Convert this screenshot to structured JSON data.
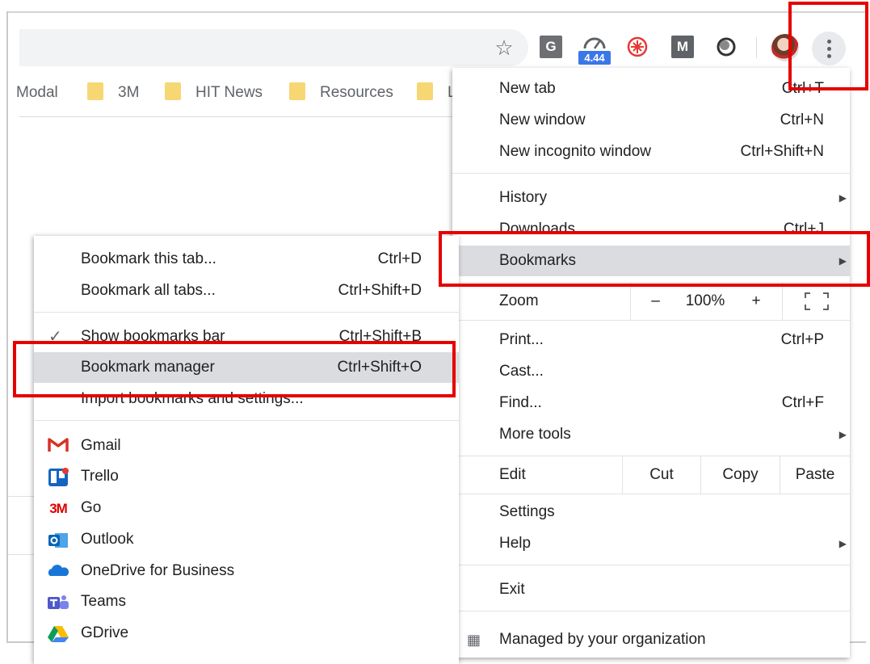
{
  "toolbar": {
    "ext_g_label": "G",
    "ext_speed_badge": "4.44",
    "ext_m_label": "M"
  },
  "bookmarks_bar": {
    "items": [
      {
        "label": "Modal"
      },
      {
        "label": "3M"
      },
      {
        "label": "HIT News"
      },
      {
        "label": "Resources"
      },
      {
        "label": "L"
      }
    ]
  },
  "main_menu": {
    "new_tab": {
      "label": "New tab",
      "shortcut": "Ctrl+T"
    },
    "new_window": {
      "label": "New window",
      "shortcut": "Ctrl+N"
    },
    "new_incognito": {
      "label": "New incognito window",
      "shortcut": "Ctrl+Shift+N"
    },
    "history": {
      "label": "History"
    },
    "downloads": {
      "label": "Downloads",
      "shortcut": "Ctrl+J"
    },
    "bookmarks": {
      "label": "Bookmarks"
    },
    "zoom": {
      "label": "Zoom",
      "minus": "–",
      "value": "100%",
      "plus": "+"
    },
    "print": {
      "label": "Print...",
      "shortcut": "Ctrl+P"
    },
    "cast": {
      "label": "Cast..."
    },
    "find": {
      "label": "Find...",
      "shortcut": "Ctrl+F"
    },
    "more_tools": {
      "label": "More tools"
    },
    "edit": {
      "label": "Edit",
      "cut": "Cut",
      "copy": "Copy",
      "paste": "Paste"
    },
    "settings": {
      "label": "Settings"
    },
    "help": {
      "label": "Help"
    },
    "exit": {
      "label": "Exit"
    },
    "managed": {
      "label": "Managed by your organization"
    }
  },
  "bookmarks_submenu": {
    "bookmark_tab": {
      "label": "Bookmark this tab...",
      "shortcut": "Ctrl+D"
    },
    "bookmark_all": {
      "label": "Bookmark all tabs...",
      "shortcut": "Ctrl+Shift+D"
    },
    "show_bar": {
      "label": "Show bookmarks bar",
      "shortcut": "Ctrl+Shift+B"
    },
    "manager": {
      "label": "Bookmark manager",
      "shortcut": "Ctrl+Shift+O"
    },
    "import": {
      "label": "Import bookmarks and settings..."
    },
    "bookmarks": [
      {
        "label": "Gmail",
        "icon": "gmail-icon"
      },
      {
        "label": "Trello",
        "icon": "trello-icon"
      },
      {
        "label": "Go",
        "icon": "3m-icon",
        "icon_text": "3M"
      },
      {
        "label": "Outlook",
        "icon": "outlook-icon"
      },
      {
        "label": "OneDrive for Business",
        "icon": "onedrive-icon"
      },
      {
        "label": "Teams",
        "icon": "teams-icon"
      },
      {
        "label": "GDrive",
        "icon": "gdrive-icon"
      }
    ]
  },
  "colors": {
    "highlight_box": "#e60000",
    "menu_highlight": "#dadce0",
    "folder": "#f7d774"
  }
}
